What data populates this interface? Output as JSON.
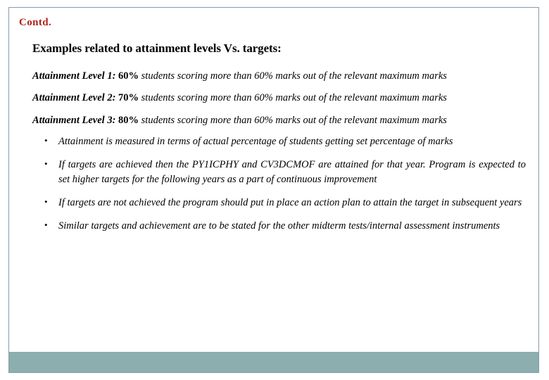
{
  "slide": {
    "title": "Contd.",
    "title_color": "#b02418",
    "heading": "Examples related to attainment levels Vs. targets:",
    "attainment_levels": [
      {
        "label": "Attainment Level 1:",
        "percent": "60%",
        "description": "students scoring more than 60% marks out of the relevant maximum marks"
      },
      {
        "label": "Attainment Level 2:",
        "percent": "70%",
        "description": "students scoring more than 60% marks out of the relevant maximum marks"
      },
      {
        "label": "Attainment Level 3:",
        "percent": "80%",
        "description": "students scoring more than 60% marks out of the relevant maximum marks"
      }
    ],
    "bullet_marker": "•",
    "bullets": [
      "Attainment is measured in terms of actual percentage of students getting set percentage of marks",
      "If targets are achieved then the PY1ICPHY and CV3DCMOF are attained for that year. Program is expected to set higher targets for the following years as a part of continuous improvement",
      "If targets are not achieved the program should put in place an action plan to attain the target in subsequent years",
      "Similar targets and achievement are to be stated for the other midterm tests/internal assessment instruments"
    ],
    "footer_bar_color": "#8caeae",
    "border_color": "#8a9ba8"
  }
}
